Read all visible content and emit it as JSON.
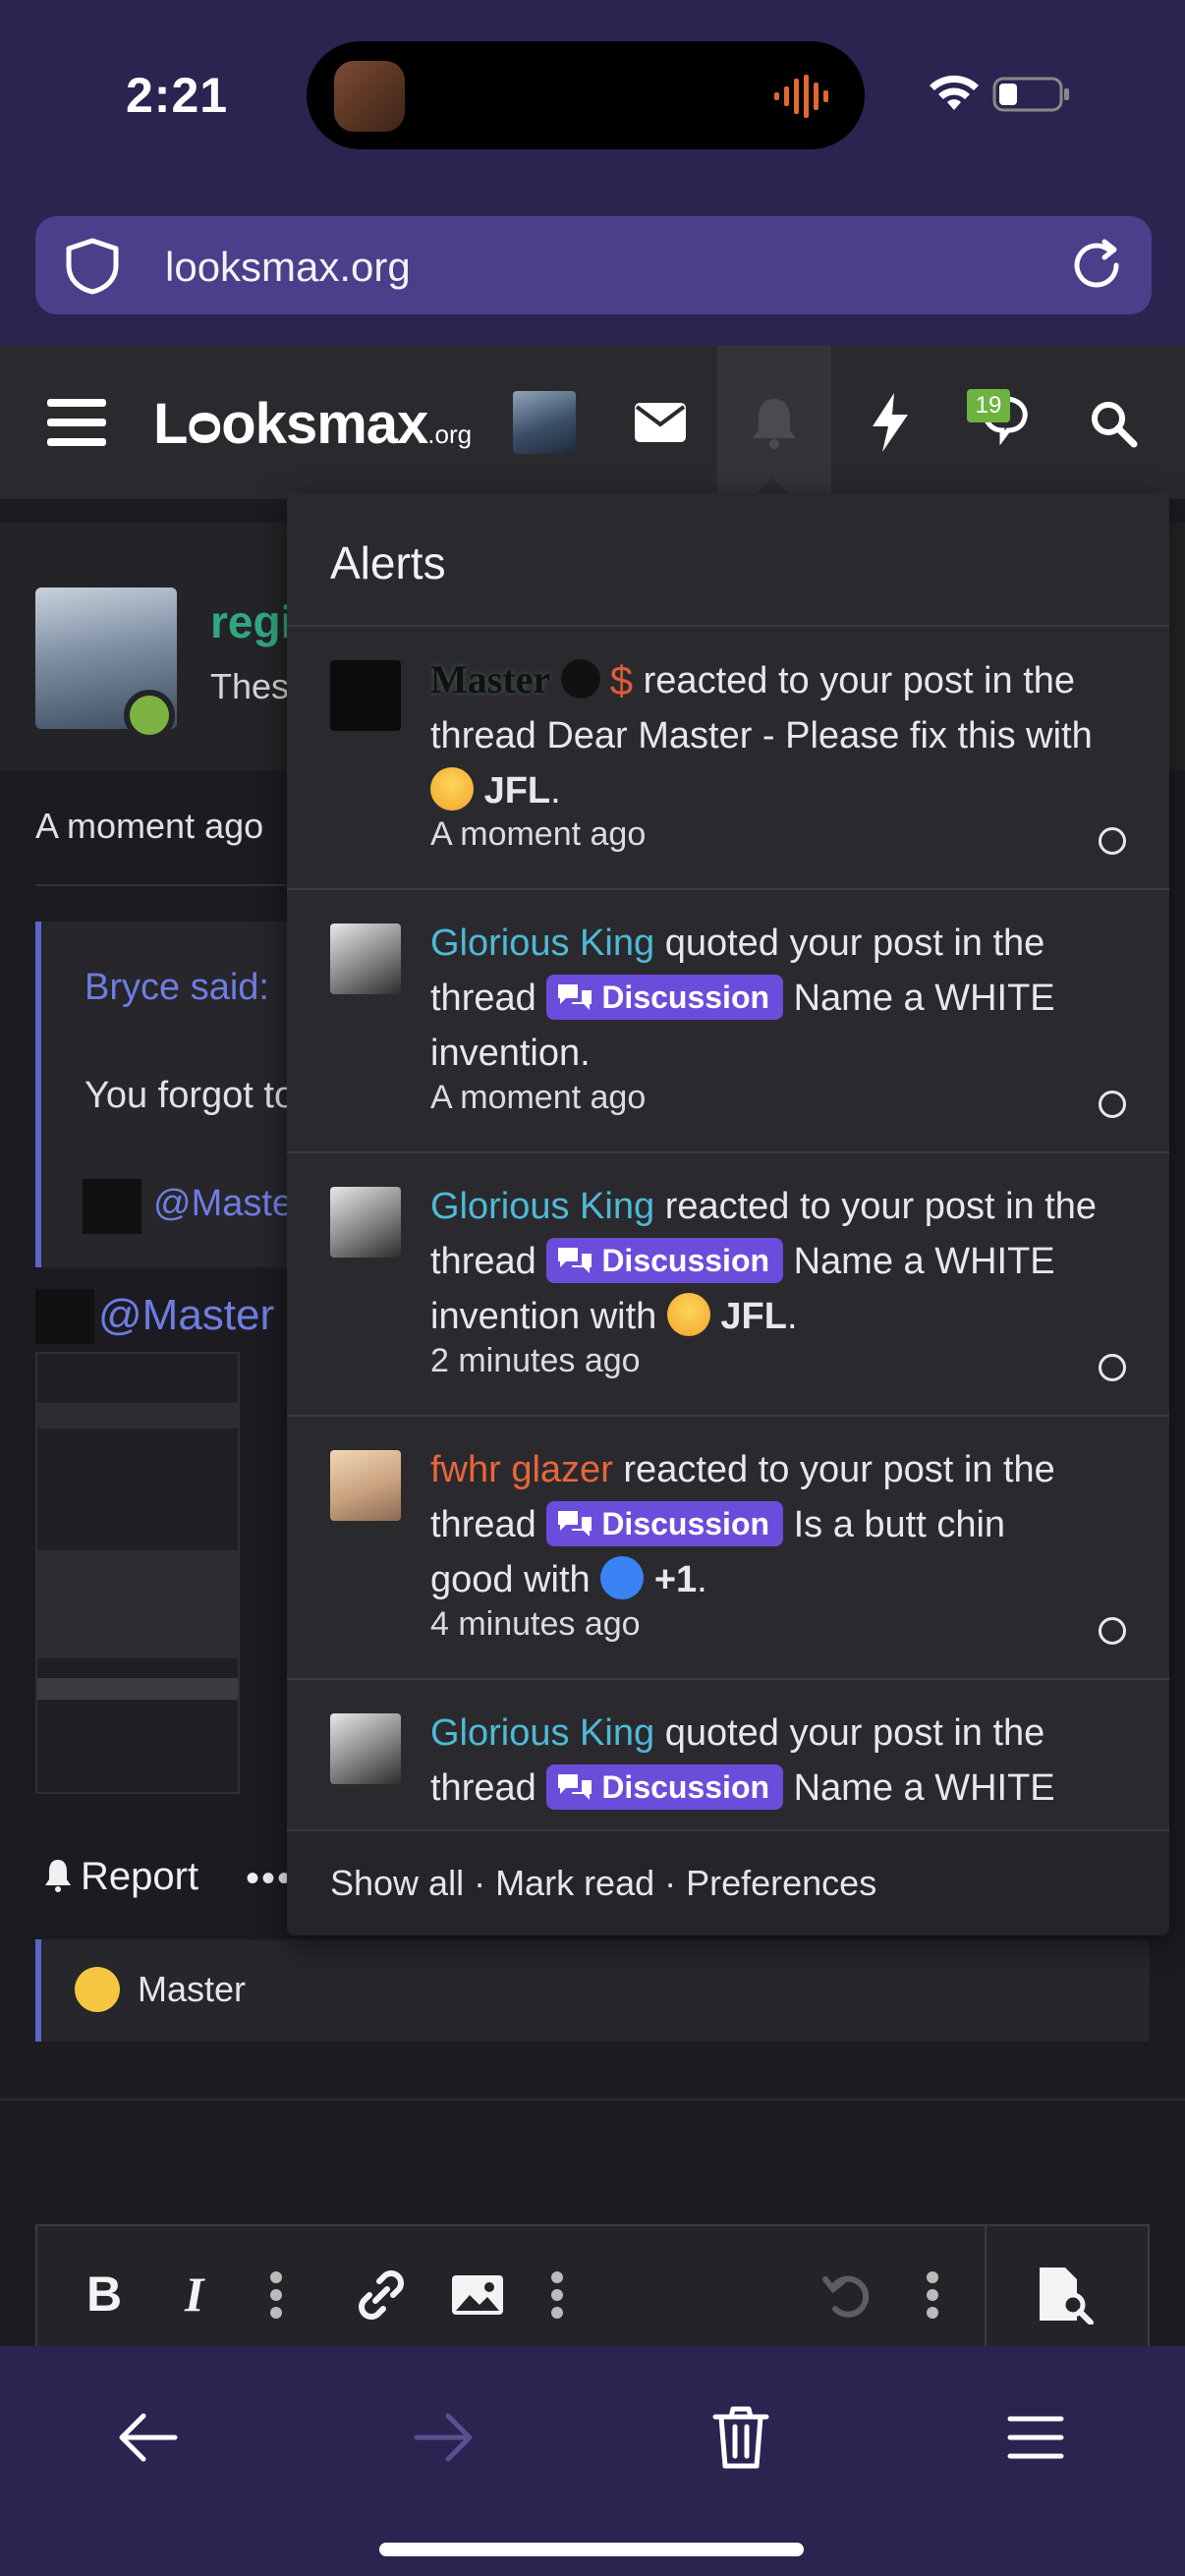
{
  "status_bar": {
    "time": "2:21"
  },
  "browser": {
    "url": "looksmax.org",
    "icons": [
      "shield-icon",
      "reload-icon",
      "back-icon",
      "forward-icon",
      "trash-icon",
      "menu-icon"
    ]
  },
  "header": {
    "logo_main": "Lᴑoksmax",
    "logo_suffix": ".org",
    "chat_badge": "19",
    "icons": [
      "hamburger-icon",
      "mail-icon",
      "bell-icon",
      "bolt-icon",
      "chat-icon",
      "search-icon"
    ]
  },
  "page": {
    "post_user": "regi",
    "post_sub": "Thes",
    "post_time": "A moment ago",
    "quote_author": "Bryce said:",
    "quote_text": "You forgot to",
    "quote_mention": "@Master",
    "mention2": "@Master",
    "report_label": "Report",
    "more_label": "•••",
    "reaction_user": "Master"
  },
  "alerts": {
    "title": "Alerts",
    "items": [
      {
        "user": "Master",
        "action": "reacted to your post in the thread",
        "thread": "Dear Master - Please fix this",
        "with": "with",
        "reaction": "JFL",
        "time": "A moment ago"
      },
      {
        "user": "Glorious King",
        "action": "quoted your post in the thread",
        "tag": "Discussion",
        "thread": "Name a WHITE invention.",
        "time": "A moment ago"
      },
      {
        "user": "Glorious King",
        "action": "reacted to your post in the thread",
        "tag": "Discussion",
        "thread": "Name a WHITE invention",
        "with": "with",
        "reaction": "JFL",
        "time": "2 minutes ago"
      },
      {
        "user": "fwhr glazer",
        "action": "reacted to your post in the thread",
        "tag": "Discussion",
        "thread": "Is a butt chin good",
        "with": "with",
        "reaction": "+1",
        "time": "4 minutes ago"
      },
      {
        "user": "Glorious King",
        "action": "quoted your post in the thread",
        "tag": "Discussion",
        "thread": "Name a WHITE"
      }
    ],
    "footer": "Show all · Mark read · Preferences"
  },
  "colors": {
    "browser_chrome": "#2b2350",
    "url_bar": "#4a3f8a",
    "site_header": "#2a2a2e",
    "tag_purple": "#6a4ddb",
    "user_blue": "#4fb9d6",
    "user_orange": "#e8663a"
  }
}
